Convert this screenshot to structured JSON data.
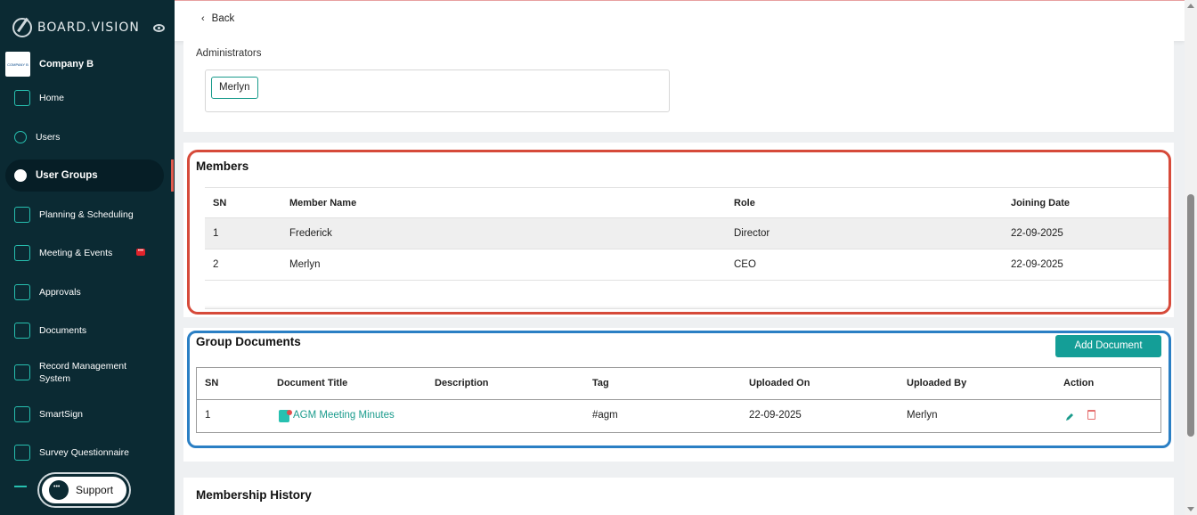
{
  "brand": {
    "name": "BOARD.VISION"
  },
  "company": {
    "name": "Company B",
    "logo_text": "COMPANY B"
  },
  "sidebar": {
    "items": [
      {
        "label": "Home"
      },
      {
        "label": "Users"
      },
      {
        "label": "User Groups"
      },
      {
        "label": "Planning & Scheduling"
      },
      {
        "label": "Meeting & Events",
        "badge": "•••"
      },
      {
        "label": "Approvals"
      },
      {
        "label": "Documents"
      },
      {
        "label": "Record Management System"
      },
      {
        "label": "SmartSign"
      },
      {
        "label": "Survey Questionnaire"
      }
    ],
    "support_label": "Support"
  },
  "topbar": {
    "back_label": "Back"
  },
  "administrators": {
    "label": "Administrators",
    "chips": [
      "Merlyn"
    ]
  },
  "members": {
    "title": "Members",
    "columns": [
      "SN",
      "Member Name",
      "Role",
      "Joining Date"
    ],
    "rows": [
      [
        "1",
        "Frederick",
        "Director",
        "22-09-2025"
      ],
      [
        "2",
        "Merlyn",
        "CEO",
        "22-09-2025"
      ]
    ]
  },
  "group_documents": {
    "title": "Group Documents",
    "add_button": "Add Document",
    "columns": [
      "SN",
      "Document Title",
      "Description",
      "Tag",
      "Uploaded On",
      "Uploaded By",
      "Action"
    ],
    "rows": [
      {
        "sn": "1",
        "title": "AGM Meeting Minutes",
        "description": "",
        "tag": "#agm",
        "uploaded_on": "22-09-2025",
        "uploaded_by": "Merlyn"
      }
    ]
  },
  "membership_history": {
    "title": "Membership History"
  },
  "colors": {
    "sidebar_bg": "#0b2a33",
    "accent": "#149e97",
    "highlight_red": "#d64a3a",
    "highlight_blue": "#2a7fc4"
  }
}
